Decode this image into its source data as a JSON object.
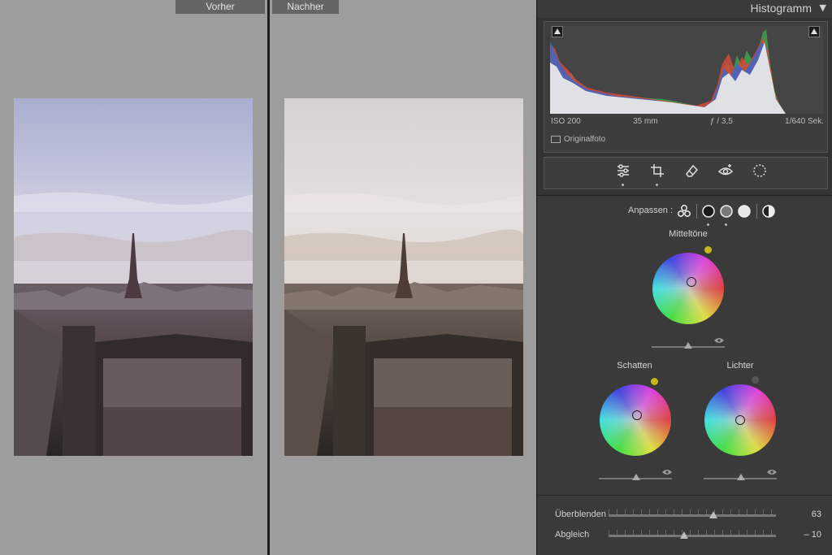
{
  "compare": {
    "before_label": "Vorher",
    "after_label": "Nachher"
  },
  "histogram": {
    "title": "Histogramm",
    "toggle_icon": "triangle-down-icon",
    "exif": {
      "iso": "ISO 200",
      "focal_length": "35 mm",
      "aperture": "ƒ / 3,5",
      "shutter": "1/640 Sek."
    },
    "original_photo_label": "Originalfoto"
  },
  "tools": [
    "sliders-icon",
    "crop-icon",
    "eraser-icon",
    "redeye-icon",
    "mask-icon"
  ],
  "color_grading": {
    "adjust_label": "Anpassen :",
    "modes": [
      "three-way-icon",
      "shadows-mode-icon",
      "midtones-mode-icon",
      "highlights-mode-icon",
      "global-mode-icon"
    ],
    "midtones_label": "Mitteltöne",
    "shadows_label": "Schatten",
    "highlights_label": "Lichter",
    "indicator_colors": {
      "midtones": "#c8b81c",
      "shadows": "#c8b81c",
      "highlights": "#555555"
    },
    "blend": {
      "label": "Überblenden",
      "value": "63"
    },
    "balance": {
      "label": "Abgleich",
      "value": "– 10"
    }
  }
}
